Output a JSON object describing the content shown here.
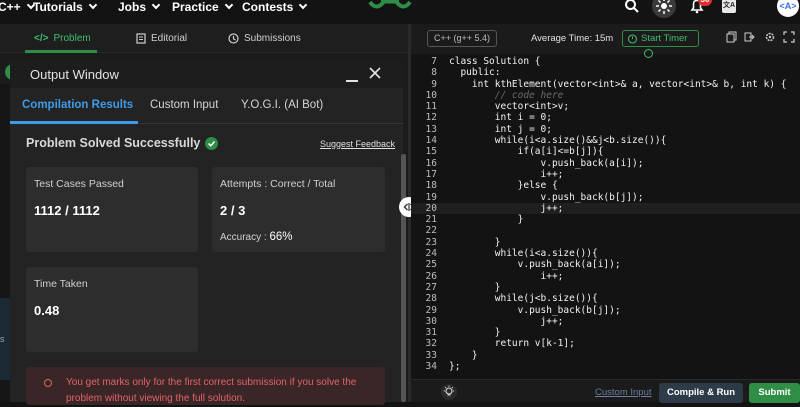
{
  "nav": {
    "items": [
      {
        "label": "C++"
      },
      {
        "label": "Tutorials"
      },
      {
        "label": "Jobs"
      },
      {
        "label": "Practice"
      },
      {
        "label": "Contests"
      }
    ],
    "notification_count": "50",
    "translate_icon_text": "文A"
  },
  "problem_tabs": {
    "problem": "Problem",
    "editorial": "Editorial",
    "submissions": "Submissions"
  },
  "left_strip_text": "s",
  "output_window": {
    "title": "Output Window",
    "tabs": [
      {
        "label": "Compilation Results"
      },
      {
        "label": "Custom Input"
      },
      {
        "label": "Y.O.G.I. (AI Bot)"
      }
    ],
    "status": "Problem Solved Successfully",
    "suggest_feedback": "Suggest Feedback",
    "test_cases": {
      "label": "Test Cases Passed",
      "value": "1112 / 1112"
    },
    "attempts": {
      "label": "Attempts : Correct / Total",
      "value": "2 / 3",
      "accuracy_label": "Accuracy :",
      "accuracy_value": "66%"
    },
    "time_taken": {
      "label": "Time Taken",
      "value": "0.48"
    },
    "notice": "You get marks only for the first correct submission if you solve the problem without viewing the full solution."
  },
  "editor": {
    "language": "C++ (g++ 5.4)",
    "avg_time": "Average Time: 15m",
    "start_timer": "Start Timer",
    "code": [
      {
        "n": "7",
        "text": "class Solution {"
      },
      {
        "n": "8",
        "text": "  public:"
      },
      {
        "n": "9",
        "text": "    int kthElement(vector<int>& a, vector<int>& b, int k) {"
      },
      {
        "n": "10",
        "text": "        // code here",
        "comment": true
      },
      {
        "n": "11",
        "text": "        vector<int>v;"
      },
      {
        "n": "12",
        "text": "        int i = 0;"
      },
      {
        "n": "13",
        "text": "        int j = 0;"
      },
      {
        "n": "14",
        "text": "        while(i<a.size()&&j<b.size()){"
      },
      {
        "n": "15",
        "text": "            if(a[i]<=b[j]){"
      },
      {
        "n": "16",
        "text": "                v.push_back(a[i]);"
      },
      {
        "n": "17",
        "text": "                i++;"
      },
      {
        "n": "18",
        "text": "            }else {"
      },
      {
        "n": "19",
        "text": "                v.push_back(b[j]);"
      },
      {
        "n": "20",
        "text": "                j++;",
        "highlight": true
      },
      {
        "n": "21",
        "text": "            }"
      },
      {
        "n": "22",
        "text": ""
      },
      {
        "n": "23",
        "text": "        }"
      },
      {
        "n": "24",
        "text": "        while(i<a.size()){"
      },
      {
        "n": "25",
        "text": "            v.push_back(a[i]);"
      },
      {
        "n": "26",
        "text": "                i++;"
      },
      {
        "n": "27",
        "text": "        }"
      },
      {
        "n": "28",
        "text": "        while(j<b.size()){"
      },
      {
        "n": "29",
        "text": "            v.push_back(b[j]);"
      },
      {
        "n": "30",
        "text": "                j++;"
      },
      {
        "n": "31",
        "text": "        }"
      },
      {
        "n": "32",
        "text": "        return v[k-1];"
      },
      {
        "n": "33",
        "text": "    }"
      },
      {
        "n": "34",
        "text": "};"
      }
    ],
    "custom_input": "Custom Input",
    "compile_run": "Compile & Run",
    "submit": "Submit"
  },
  "colors": {
    "brand_green": "#2f8d46",
    "accent_blue": "#3d9be9",
    "error_red": "#e06467"
  }
}
